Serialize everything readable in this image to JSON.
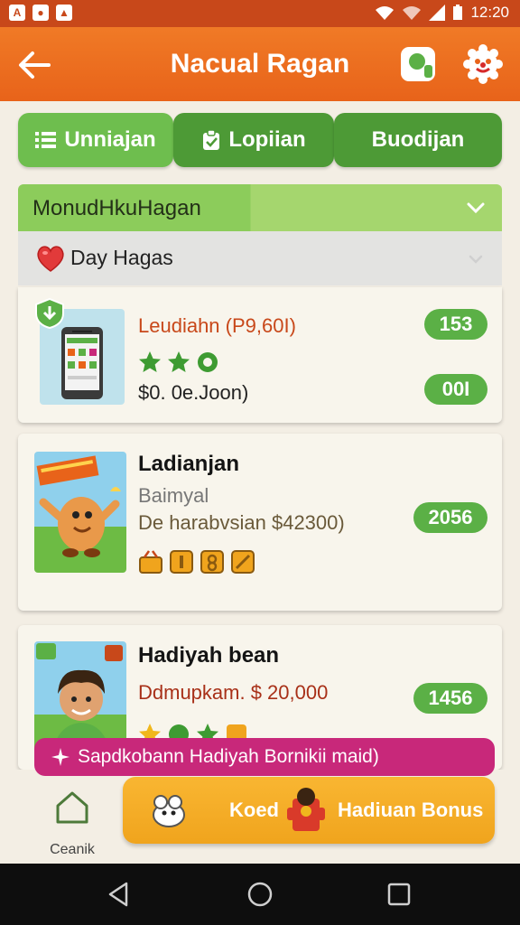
{
  "status_bar": {
    "time": "12:20"
  },
  "header": {
    "title": "Nacual Ragan"
  },
  "tabs": [
    {
      "label": "Unniajan"
    },
    {
      "label": "Lopiian"
    },
    {
      "label": "Buodijan"
    }
  ],
  "section": {
    "title": "MonudHkuHagan",
    "sub_title": "Day Hagas"
  },
  "cards": [
    {
      "title": "Leudiahn (P9,60I)",
      "price": "$0. 0e.Joon)",
      "badge_top": "153",
      "badge_bottom": "00I"
    },
    {
      "title": "Ladianjan",
      "subtitle": "Baimyal",
      "description": "De harabvsian $42300)",
      "badge": "2056"
    },
    {
      "title": "Hadiyah bean",
      "description": "Ddmupkam. $ 20,000",
      "badge": "1456"
    }
  ],
  "banner": {
    "text": "Sapdkobann Hadiyah Bornikii maid)"
  },
  "bottom_nav": {
    "home_label": "Ceanik",
    "koed_label": "Koed",
    "bonus_label": "Hadiuan Bonus"
  },
  "colors": {
    "header": "#e8631a",
    "green": "#5bb046",
    "banner": "#c8287a",
    "bonus": "#f0a41d"
  }
}
